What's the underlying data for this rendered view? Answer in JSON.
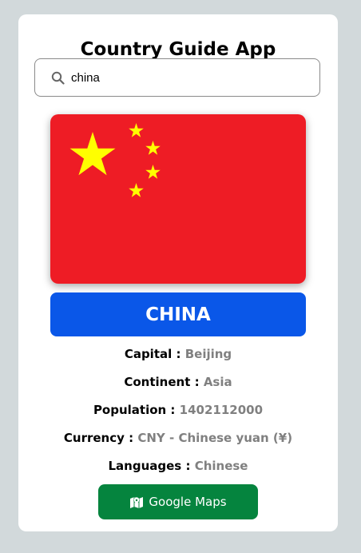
{
  "app": {
    "title": "Country Guide App"
  },
  "search": {
    "value": "china",
    "icon": "search-icon"
  },
  "flag": {
    "country": "china",
    "colors": {
      "field": "#ee1c25",
      "stars": "#ffff00"
    }
  },
  "country": {
    "name": "CHINA",
    "banner_color": "#0a57e8"
  },
  "details": [
    {
      "label": "Capital :",
      "value": "Beijing"
    },
    {
      "label": "Continent :",
      "value": "Asia"
    },
    {
      "label": "Population :",
      "value": "1402112000"
    },
    {
      "label": "Currency :",
      "value": "CNY - Chinese yuan (¥)"
    },
    {
      "label": "Languages :",
      "value": "Chinese"
    }
  ],
  "maps_button": {
    "label": "Google Maps",
    "icon": "map-icon",
    "color": "#05843e"
  }
}
